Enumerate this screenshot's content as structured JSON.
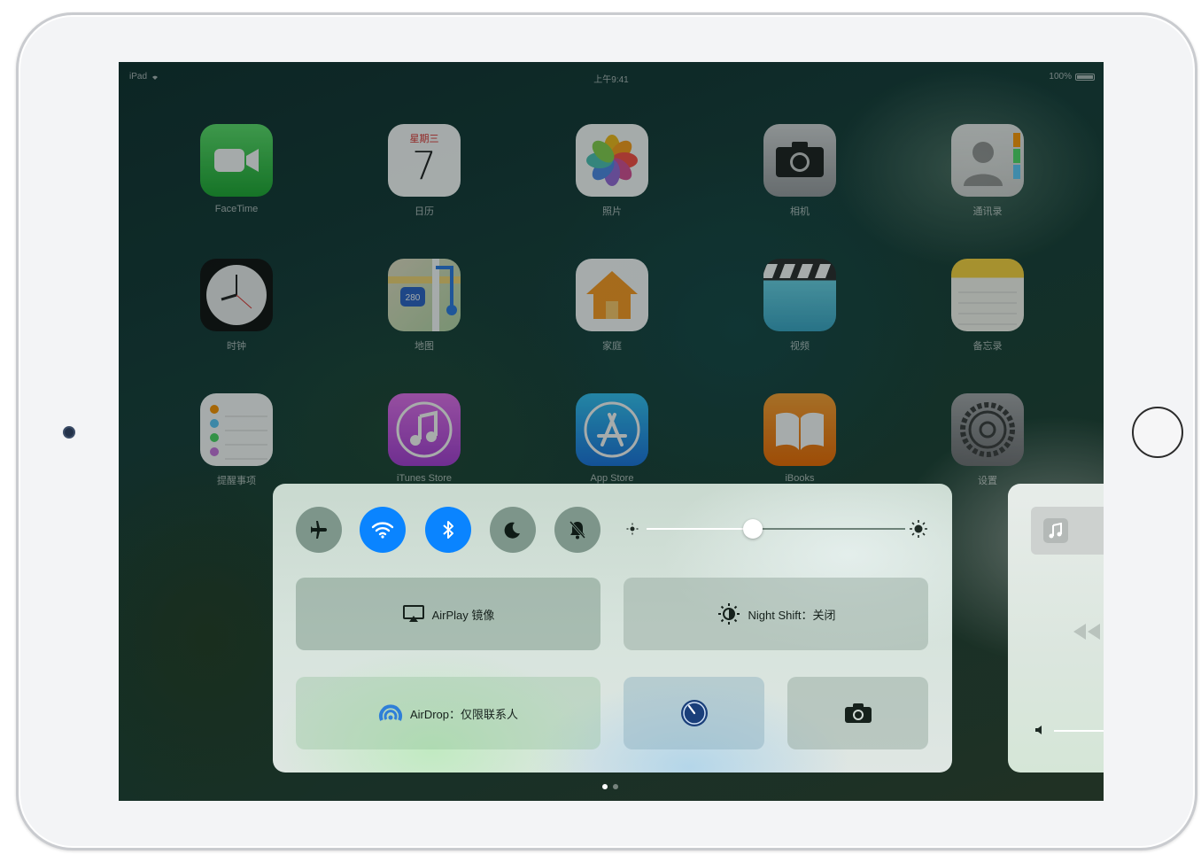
{
  "status_bar": {
    "device": "iPad",
    "time": "上午9:41",
    "battery": "100%"
  },
  "apps": [
    {
      "label": "FaceTime",
      "icon": "facetime-icon"
    },
    {
      "label": "日历",
      "icon": "calendar-icon",
      "weekday": "星期三",
      "day": "7"
    },
    {
      "label": "照片",
      "icon": "photos-icon"
    },
    {
      "label": "相机",
      "icon": "camera-app-icon"
    },
    {
      "label": "通讯录",
      "icon": "contacts-icon"
    },
    {
      "label": "时钟",
      "icon": "clock-icon"
    },
    {
      "label": "地图",
      "icon": "maps-icon",
      "road_badge": "280"
    },
    {
      "label": "家庭",
      "icon": "home-app-icon"
    },
    {
      "label": "视频",
      "icon": "videos-icon"
    },
    {
      "label": "备忘录",
      "icon": "notes-icon"
    },
    {
      "label": "提醒事项",
      "icon": "reminders-icon"
    },
    {
      "label": "iTunes Store",
      "icon": "itunes-store-icon"
    },
    {
      "label": "App Store",
      "icon": "app-store-icon"
    },
    {
      "label": "iBooks",
      "icon": "ibooks-icon"
    },
    {
      "label": "设置",
      "icon": "settings-icon"
    }
  ],
  "control_center": {
    "toggles": [
      {
        "name": "airplane-mode",
        "icon": "airplane-icon",
        "on": false
      },
      {
        "name": "wifi",
        "icon": "wifi-icon",
        "on": true
      },
      {
        "name": "bluetooth",
        "icon": "bluetooth-icon",
        "on": true
      },
      {
        "name": "do-not-disturb",
        "icon": "moon-icon",
        "on": false
      },
      {
        "name": "mute",
        "icon": "bell-slash-icon",
        "on": false
      }
    ],
    "brightness": 0.41,
    "airplay_label": "AirPlay 镜像",
    "night_shift_label": "Night Shift：关闭",
    "airdrop_label": "AirDrop：仅限联系人",
    "accent": "#0a84ff"
  },
  "page_indicator": {
    "count": 2,
    "active": 0
  }
}
